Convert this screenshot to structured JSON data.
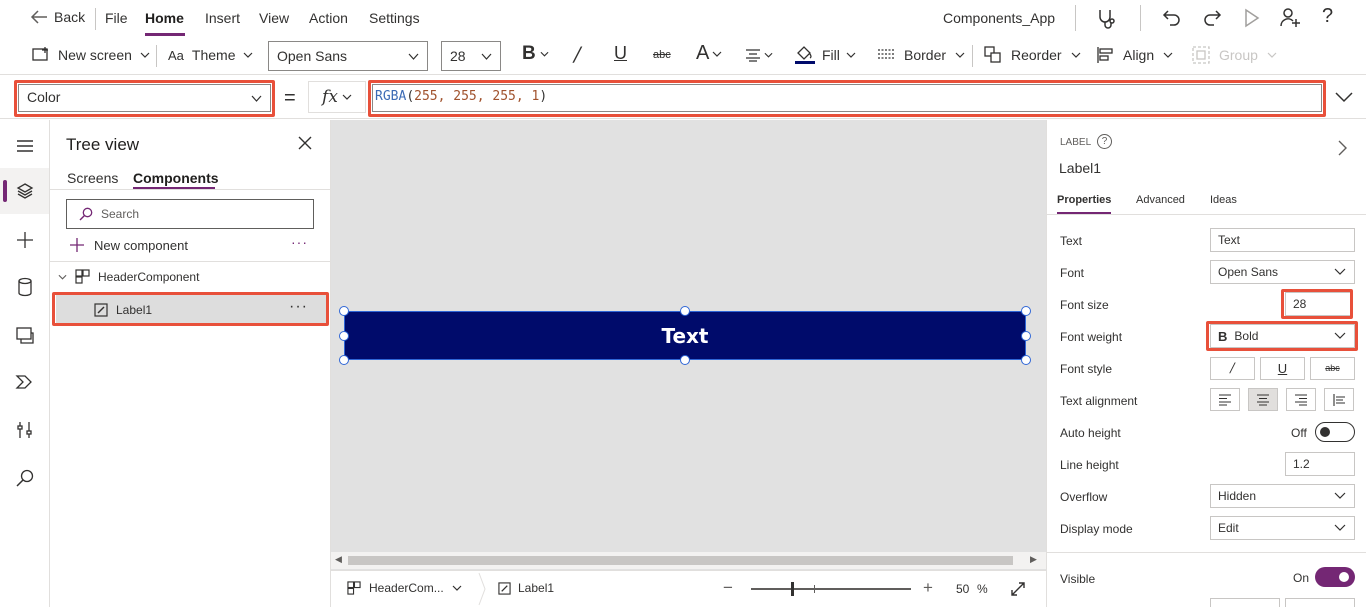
{
  "menubar": {
    "back": "Back",
    "file": "File",
    "home": "Home",
    "insert": "Insert",
    "view": "View",
    "action": "Action",
    "settings": "Settings",
    "app_name": "Components_App"
  },
  "ribbon": {
    "new_screen": "New screen",
    "theme": "Theme",
    "font": "Open Sans",
    "font_size": "28",
    "fill": "Fill",
    "border": "Border",
    "reorder": "Reorder",
    "align": "Align",
    "group": "Group"
  },
  "formula": {
    "property": "Color",
    "equals": "=",
    "fx": "fx",
    "func": "RGBA",
    "args": "255, 255, 255, 1"
  },
  "tree": {
    "title": "Tree view",
    "tabs": [
      "Screens",
      "Components"
    ],
    "search_placeholder": "Search",
    "new_component": "New component",
    "component": "HeaderComponent",
    "label_item": "Label1"
  },
  "canvas": {
    "label_text": "Text",
    "label_bg": "#000b6b"
  },
  "statusbar": {
    "crumb1": "HeaderCom...",
    "crumb2": "Label1",
    "zoom": "50",
    "zoom_unit": "%"
  },
  "props": {
    "kind": "LABEL",
    "name": "Label1",
    "tabs": [
      "Properties",
      "Advanced",
      "Ideas"
    ],
    "rows": {
      "text_label": "Text",
      "text_value": "Text",
      "font_label": "Font",
      "font_value": "Open Sans",
      "size_label": "Font size",
      "size_value": "28",
      "weight_label": "Font weight",
      "weight_value": "Bold",
      "weight_glyph": "B",
      "style_label": "Font style",
      "align_label": "Text alignment",
      "auto_label": "Auto height",
      "auto_value": "Off",
      "line_label": "Line height",
      "line_value": "1.2",
      "overflow_label": "Overflow",
      "overflow_value": "Hidden",
      "mode_label": "Display mode",
      "mode_value": "Edit",
      "visible_label": "Visible",
      "visible_value": "On"
    }
  },
  "colors": {
    "accent": "#742774",
    "highlight": "#e8503a",
    "label_bg": "#000b6b"
  }
}
